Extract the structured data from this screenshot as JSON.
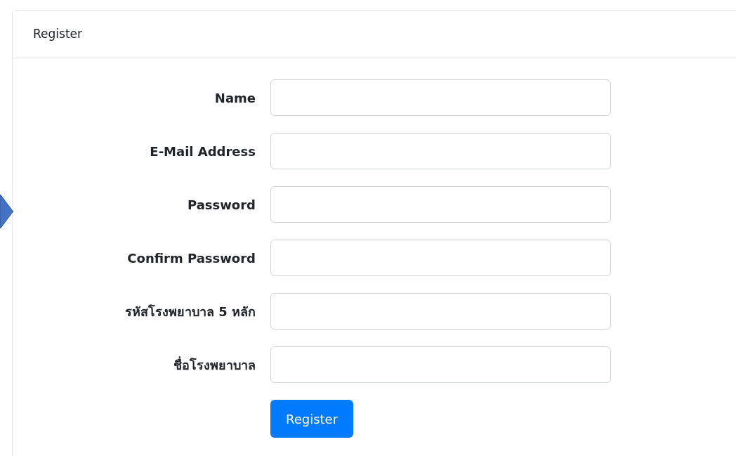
{
  "card": {
    "title": "Register"
  },
  "fields": [
    {
      "label": "Name"
    },
    {
      "label": "E-Mail Address"
    },
    {
      "label": "Password"
    },
    {
      "label": "Confirm Password"
    },
    {
      "label": "รหัสโรงพยาบาล 5 หลัก"
    },
    {
      "label": "ชื่อโรงพยาบาล"
    }
  ],
  "submit": {
    "label": "Register"
  }
}
